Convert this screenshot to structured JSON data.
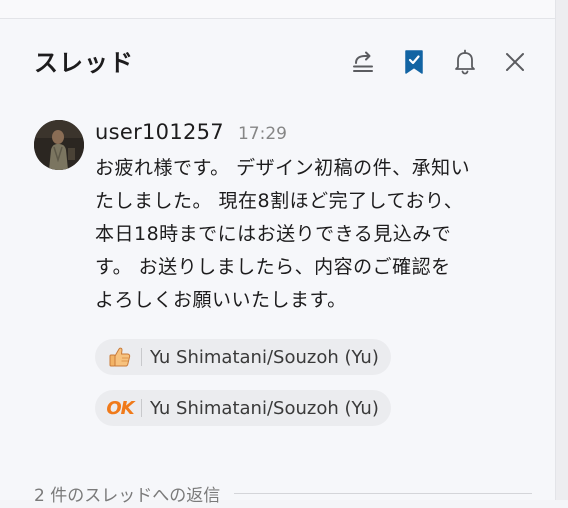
{
  "header": {
    "title": "スレッド",
    "icons": [
      "share-icon",
      "bookmark-icon",
      "bell-icon",
      "close-icon"
    ],
    "accent_color": "#1264a3"
  },
  "message": {
    "user_name": "user101257",
    "time": "17:29",
    "lines": [
      "お疲れ様です。 デザイン初稿の件、承知い",
      "たしました。 現在8割ほど完了しており、",
      "本日18時までにはお送りできる見込みで",
      "す。 お送りしましたら、内容のご確認を",
      "よろしくお願いいたします。"
    ]
  },
  "reactions": [
    {
      "emoji": "thumbs-up-icon",
      "user": "Yu Shimatani/Souzoh (Yu)"
    },
    {
      "emoji": "OK",
      "user": "Yu Shimatani/Souzoh (Yu)"
    }
  ],
  "thread": {
    "reply_count_label": "2 件のスレッドへの返信"
  }
}
